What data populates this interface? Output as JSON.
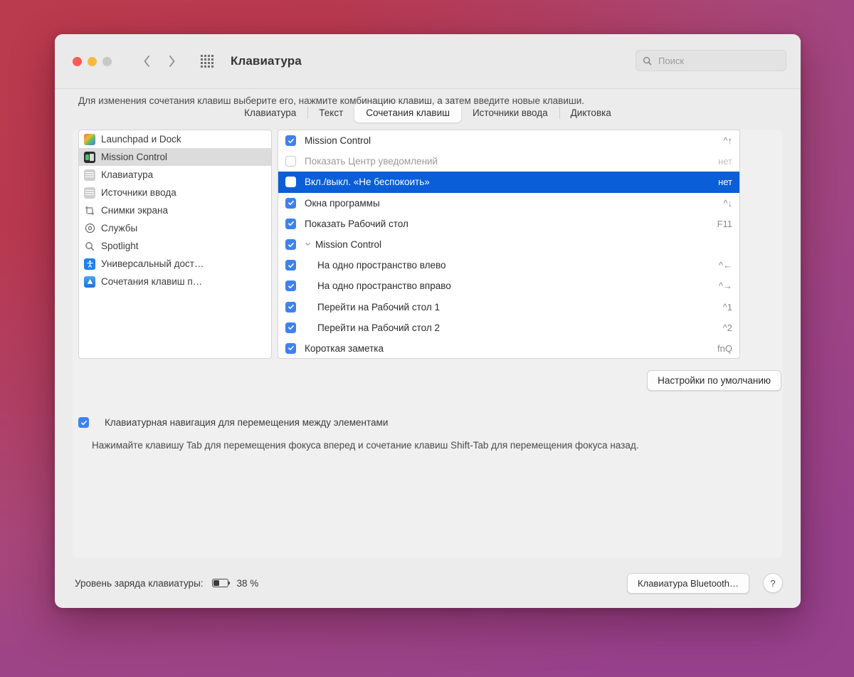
{
  "window": {
    "title": "Клавиатура",
    "traffic_lights": [
      "close",
      "minimize",
      "zoom"
    ],
    "back_icon": "chevron-left-icon",
    "forward_icon": "chevron-right-icon",
    "grid_icon": "grid-view-icon"
  },
  "search": {
    "placeholder": "Поиск",
    "value": "",
    "icon": "search-icon"
  },
  "tabs": [
    {
      "label": "Клавиатура",
      "active": false
    },
    {
      "label": "Текст",
      "active": false
    },
    {
      "label": "Сочетания клавиш",
      "active": true
    },
    {
      "label": "Источники ввода",
      "active": false
    },
    {
      "label": "Диктовка",
      "active": false
    }
  ],
  "description": "Для изменения сочетания клавиш выберите его, нажмите комбинацию клавиш, а затем введите новые клавиши.",
  "sidebar": {
    "items": [
      {
        "label": "Launchpad и Dock",
        "icon": "launchpad-icon",
        "selected": false
      },
      {
        "label": "Mission Control",
        "icon": "mission-control-icon",
        "selected": true
      },
      {
        "label": "Клавиатура",
        "icon": "keyboard-icon",
        "selected": false
      },
      {
        "label": "Источники ввода",
        "icon": "keyboard-icon",
        "selected": false
      },
      {
        "label": "Снимки экрана",
        "icon": "screenshot-icon",
        "selected": false
      },
      {
        "label": "Службы",
        "icon": "gear-icon",
        "selected": false
      },
      {
        "label": "Spotlight",
        "icon": "spotlight-search-icon",
        "selected": false
      },
      {
        "label": "Универсальный дост…",
        "icon": "accessibility-icon",
        "selected": false
      },
      {
        "label": "Сочетания клавиш п…",
        "icon": "app-shortcuts-icon",
        "selected": false
      }
    ]
  },
  "shortcut_list": {
    "rows": [
      {
        "label": "Mission Control",
        "shortcut": "^↑",
        "checked": true,
        "indent": 0,
        "selected": false,
        "dim": false,
        "group": false
      },
      {
        "label": "Показать Центр уведомлений",
        "shortcut": "нет",
        "checked": false,
        "indent": 0,
        "selected": false,
        "dim": true,
        "group": false
      },
      {
        "label": "Вкл./выкл. «Не беспокоить»",
        "shortcut": "нет",
        "checked": false,
        "indent": 0,
        "selected": true,
        "dim": false,
        "group": false
      },
      {
        "label": "Окна программы",
        "shortcut": "^↓",
        "checked": true,
        "indent": 0,
        "selected": false,
        "dim": false,
        "group": false
      },
      {
        "label": "Показать Рабочий стол",
        "shortcut": "F11",
        "checked": true,
        "indent": 0,
        "selected": false,
        "dim": false,
        "group": false
      },
      {
        "label": "Mission Control",
        "shortcut": "",
        "checked": true,
        "indent": 0,
        "selected": false,
        "dim": false,
        "group": true
      },
      {
        "label": "На одно пространство влево",
        "shortcut": "^←",
        "checked": true,
        "indent": 1,
        "selected": false,
        "dim": false,
        "group": false
      },
      {
        "label": "На одно пространство вправо",
        "shortcut": "^→",
        "checked": true,
        "indent": 1,
        "selected": false,
        "dim": false,
        "group": false
      },
      {
        "label": "Перейти на Рабочий стол 1",
        "shortcut": "^1",
        "checked": true,
        "indent": 1,
        "selected": false,
        "dim": false,
        "group": false
      },
      {
        "label": "Перейти на Рабочий стол 2",
        "shortcut": "^2",
        "checked": true,
        "indent": 1,
        "selected": false,
        "dim": false,
        "group": false
      },
      {
        "label": "Короткая заметка",
        "shortcut": "fnQ",
        "checked": true,
        "indent": 0,
        "selected": false,
        "dim": false,
        "group": false
      }
    ]
  },
  "defaults_button": "Настройки по умолчанию",
  "keyboard_navigation": {
    "checked": true,
    "label": "Клавиатурная навигация для перемещения между элементами",
    "hint": "Нажимайте клавишу Tab для перемещения фокуса вперед и сочетание клавиш Shift-Tab для перемещения фокуса назад."
  },
  "footer": {
    "battery_label": "Уровень заряда клавиатуры:",
    "battery_percent": "38 %",
    "battery_fill": 38,
    "bluetooth_button": "Клавиатура Bluetooth…",
    "help_button": "?"
  },
  "colors": {
    "selection_blue": "#0a5ed7",
    "checkbox_blue": "#3d82f0",
    "window_bg": "#ececec",
    "desktop_gradient_start": "#bb3a4d",
    "desktop_gradient_end": "#97418c"
  }
}
